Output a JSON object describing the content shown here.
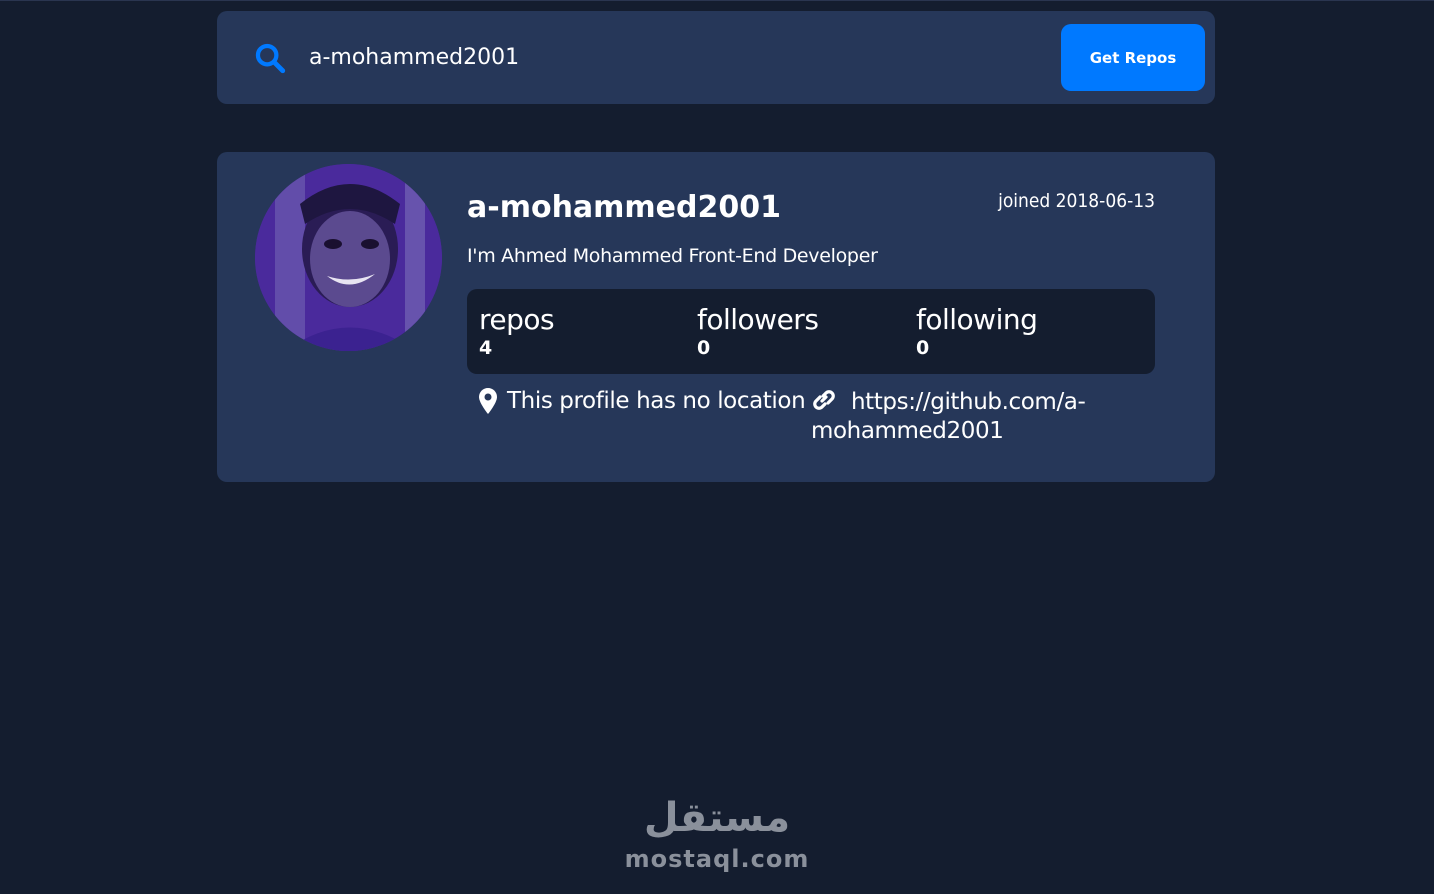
{
  "search": {
    "value": "a-mohammed2001",
    "button_label": "Get Repos"
  },
  "profile": {
    "username": "a-mohammed2001",
    "joined": "joined 2018-06-13",
    "bio": "I'm Ahmed Mohammed Front-End Developer",
    "stats": [
      {
        "label": "repos",
        "value": "4"
      },
      {
        "label": "followers",
        "value": "0"
      },
      {
        "label": "following",
        "value": "0"
      }
    ],
    "location": "This profile has no location",
    "blog": "https://github.com/a-mohammed2001"
  },
  "watermark": {
    "arabic": "مستقل",
    "latin": "mostaql.com"
  },
  "colors": {
    "background": "#141d2f",
    "card": "#263759",
    "accent": "#0079ff"
  },
  "icons": {
    "search": "search-icon",
    "location": "map-pin-icon",
    "link": "link-icon"
  }
}
